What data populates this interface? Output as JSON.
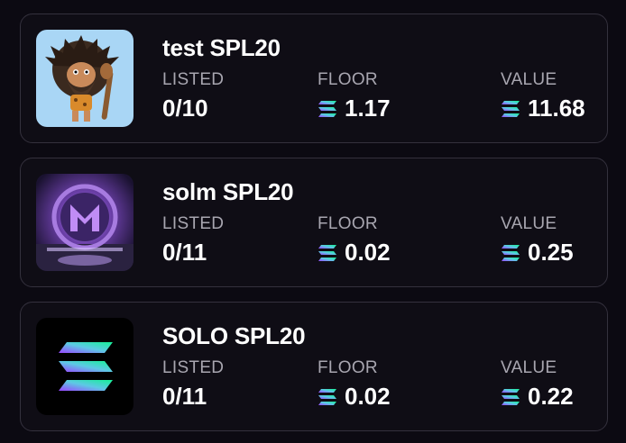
{
  "labels": {
    "listed": "LISTED",
    "floor": "FLOOR",
    "value": "VALUE"
  },
  "colors": {
    "sol_gradient_start": "#14f195",
    "sol_gradient_mid": "#5ec8e5",
    "sol_gradient_end": "#9945ff"
  },
  "collections": [
    {
      "name": "test SPL20",
      "listed": "0/10",
      "floor": "1.17",
      "value": "11.68",
      "thumbnail": "caveman-avatar",
      "currency_icon": "solana-icon"
    },
    {
      "name": "solm SPL20",
      "listed": "0/11",
      "floor": "0.02",
      "value": "0.25",
      "thumbnail": "purple-m-portal-logo",
      "currency_icon": "solana-icon"
    },
    {
      "name": "SOLO SPL20",
      "listed": "0/11",
      "floor": "0.02",
      "value": "0.22",
      "thumbnail": "solana-logo",
      "currency_icon": "solana-icon"
    }
  ]
}
